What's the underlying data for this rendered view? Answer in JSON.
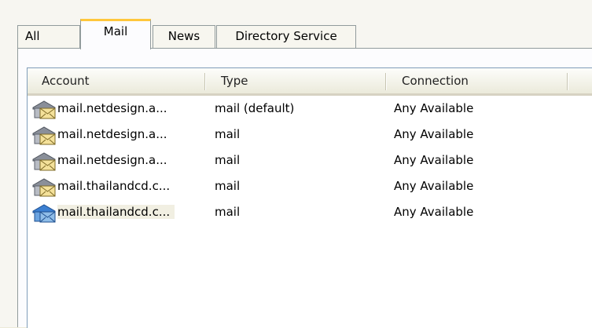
{
  "tabs": [
    {
      "label": "All"
    },
    {
      "label": "Mail"
    },
    {
      "label": "News"
    },
    {
      "label": "Directory Service"
    }
  ],
  "active_tab": "Mail",
  "columns": {
    "account": "Account",
    "type": "Type",
    "connection": "Connection"
  },
  "accounts": [
    {
      "account": "mail.netdesign.a...",
      "type": "mail (default)",
      "connection": "Any Available",
      "icon": "mail-account-icon"
    },
    {
      "account": "mail.netdesign.a...",
      "type": "mail",
      "connection": "Any Available",
      "icon": "mail-account-icon"
    },
    {
      "account": "mail.netdesign.a...",
      "type": "mail",
      "connection": "Any Available",
      "icon": "mail-account-icon"
    },
    {
      "account": "mail.thailandcd.c...",
      "type": "mail",
      "connection": "Any Available",
      "icon": "mail-account-icon"
    },
    {
      "account": "mail.thailandcd.c...",
      "type": "mail",
      "connection": "Any Available",
      "icon": "mail-account-icon-selected"
    }
  ],
  "selected_row": 4,
  "colors": {
    "tab_highlight": "#ffc73c",
    "selection_icon": "#3b7fd1"
  }
}
